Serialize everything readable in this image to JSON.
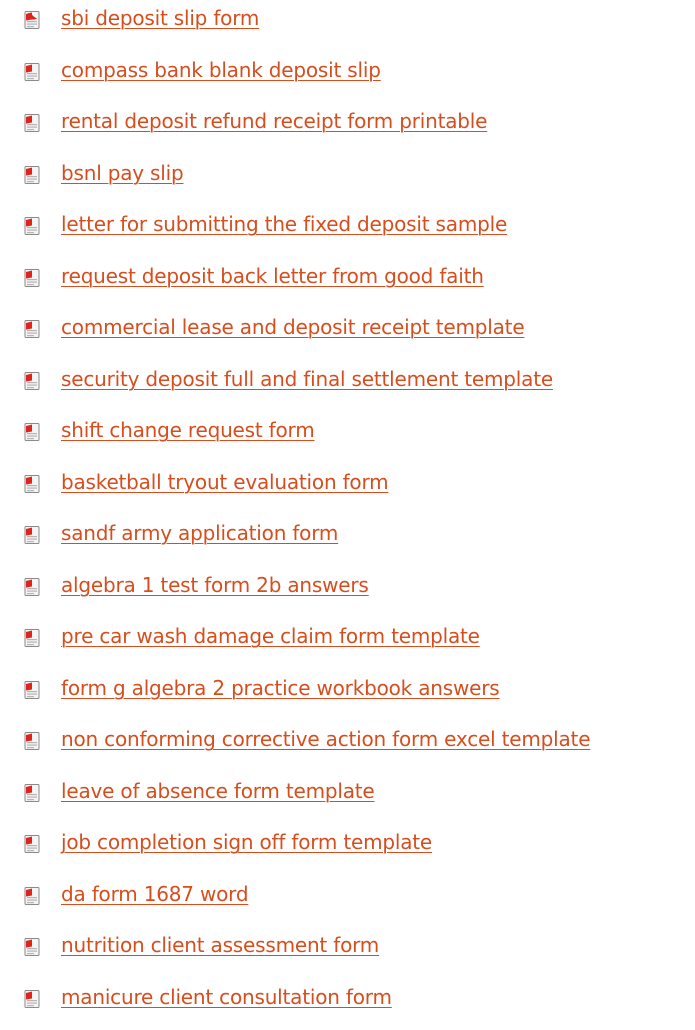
{
  "theme": {
    "link_color": "#d64e1e",
    "icon_red": "#e0231b",
    "icon_grey": "#8a8a8a"
  },
  "links": [
    {
      "label": "sbi deposit slip form",
      "icon": "pdf-file-icon"
    },
    {
      "label": "compass bank blank deposit slip",
      "icon": "pdf-file-icon"
    },
    {
      "label": "rental deposit refund receipt form printable",
      "icon": "pdf-file-icon"
    },
    {
      "label": "bsnl pay slip",
      "icon": "pdf-file-icon"
    },
    {
      "label": "letter for submitting the fixed deposit sample",
      "icon": "pdf-file-icon"
    },
    {
      "label": "request deposit back letter from good faith",
      "icon": "pdf-file-icon"
    },
    {
      "label": "commercial lease and deposit receipt template",
      "icon": "pdf-file-icon"
    },
    {
      "label": "security deposit full and final settlement template",
      "icon": "pdf-file-icon"
    },
    {
      "label": "shift change request form",
      "icon": "pdf-file-icon"
    },
    {
      "label": "basketball tryout evaluation form",
      "icon": "pdf-file-icon"
    },
    {
      "label": "sandf army application form",
      "icon": "pdf-file-icon"
    },
    {
      "label": "algebra 1 test form 2b answers",
      "icon": "pdf-file-icon"
    },
    {
      "label": "pre car wash damage claim form template",
      "icon": "pdf-file-icon"
    },
    {
      "label": "form g algebra 2 practice workbook answers",
      "icon": "pdf-file-icon"
    },
    {
      "label": "non conforming corrective action form excel template",
      "icon": "pdf-file-icon"
    },
    {
      "label": "leave of absence form template",
      "icon": "pdf-file-icon"
    },
    {
      "label": "job completion sign off form template",
      "icon": "pdf-file-icon"
    },
    {
      "label": "da form 1687 word",
      "icon": "pdf-file-icon"
    },
    {
      "label": "nutrition client assessment form",
      "icon": "pdf-file-icon"
    },
    {
      "label": "manicure client consultation form",
      "icon": "pdf-file-icon"
    }
  ]
}
